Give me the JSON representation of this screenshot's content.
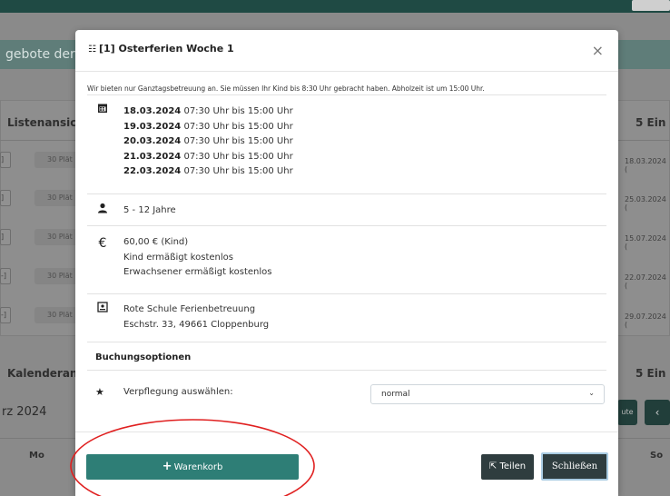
{
  "background": {
    "band_text": "gebote der F",
    "left_heading_list": "Listenansicl",
    "right_count_1": "5 Ein",
    "left_heading_calendar": "Kalenderan",
    "right_count_2": "5 Ein",
    "month": "rz 2024",
    "day_mo": "Mo",
    "day_so": "So",
    "button_partial": "ute",
    "rows": [
      {
        "chip": "]",
        "pill": "30 Plät",
        "date": "18.03.2024 ("
      },
      {
        "chip": "]",
        "pill": "30 Plät",
        "date": "25.03.2024 ("
      },
      {
        "chip": "]",
        "pill": "30 Plät",
        "date": "15.07.2024 ("
      },
      {
        "chip": "-]",
        "pill": "30 Plät",
        "date": "22.07.2024 ("
      },
      {
        "chip": "-]",
        "pill": "30 Plät",
        "date": "29.07.2024 ("
      }
    ]
  },
  "modal": {
    "title": "[1] Osterferien Woche 1",
    "close_symbol": "×",
    "intro": "Wir bieten nur Ganztagsbetreuung an. Sie müssen Ihr Kind bis 8:30 Uhr gebracht haben. Abholzeit ist um 15:00 Uhr.",
    "dates": [
      {
        "date": "18.03.2024",
        "time": "07:30 Uhr bis 15:00 Uhr"
      },
      {
        "date": "19.03.2024",
        "time": "07:30 Uhr bis 15:00 Uhr"
      },
      {
        "date": "20.03.2024",
        "time": "07:30 Uhr bis 15:00 Uhr"
      },
      {
        "date": "21.03.2024",
        "time": "07:30 Uhr bis 15:00 Uhr"
      },
      {
        "date": "22.03.2024",
        "time": "07:30 Uhr bis 15:00 Uhr"
      }
    ],
    "age": "5 - 12 Jahre",
    "prices": [
      "60,00 € (Kind)",
      "Kind ermäßigt kostenlos",
      "Erwachsener ermäßigt kostenlos"
    ],
    "location": [
      "Rote Schule Ferienbetreuung",
      "Eschstr. 33, 49661 Cloppenburg"
    ],
    "options_title": "Buchungsoptionen",
    "option_label": "Verpflegung auswählen:",
    "option_value": "normal",
    "cart_button": "Warenkorb",
    "share_button": "Teilen",
    "close_button": "Schließen"
  },
  "icons": {
    "calendar": "calendar-icon",
    "person": "person-icon",
    "euro": "euro-icon",
    "location": "location-icon",
    "star": "star-icon"
  },
  "colors": {
    "primary": "#2e7e76",
    "dark_button": "#2f3d3f",
    "annotation": "#e02020"
  }
}
